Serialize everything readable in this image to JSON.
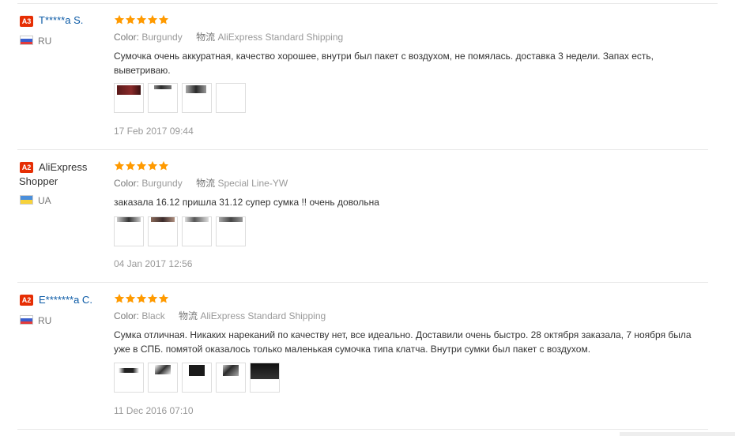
{
  "colors": {
    "badge": "#e62e04",
    "star": "#ff9a00",
    "link": "#0b5aa6"
  },
  "reviews": [
    {
      "badge": "A3",
      "name_line1": "T*****a S.",
      "name_line2": "",
      "country": "RU",
      "flag": "ru",
      "stars": 5,
      "color_label": "Color:",
      "color_value": "Burgundy",
      "shipping_label": "物流",
      "shipping_value": "AliExpress Standard Shipping",
      "text": "Сумочка очень аккуратная, качество хорошее, внутри был пакет с воздухом, не помялась. доставка 3 недели. Запах есть, выветриваю.",
      "thumbs": [
        "photo",
        "photo",
        "photo",
        "photo"
      ],
      "date": "17 Feb 2017 09:44"
    },
    {
      "badge": "A2",
      "name_line1": "AliExpress",
      "name_line2": "Shopper",
      "country": "UA",
      "flag": "ua",
      "stars": 5,
      "color_label": "Color:",
      "color_value": "Burgundy",
      "shipping_label": "物流",
      "shipping_value": "Special Line-YW",
      "text": "заказала 16.12 пришла 31.12 супер сумка !! очень довольна",
      "thumbs": [
        "photo",
        "photo",
        "photo",
        "photo"
      ],
      "date": "04 Jan 2017 12:56"
    },
    {
      "badge": "A2",
      "name_line1": "E*******a C.",
      "name_line2": "",
      "country": "RU",
      "flag": "ru",
      "stars": 5,
      "color_label": "Color:",
      "color_value": "Black",
      "shipping_label": "物流",
      "shipping_value": "AliExpress Standard Shipping",
      "text": "Сумка отличная. Никаких нареканий по качеству нет, все идеально. Доставили очень быстро. 28 октября заказала, 7 ноября была уже в СПБ. помятой оказалось только маленькая сумочка типа клатча. Внутри сумки был пакет с воздухом.",
      "thumbs": [
        "photo",
        "photo",
        "photo",
        "photo",
        "photo"
      ],
      "date": "11 Dec 2016 07:10"
    }
  ]
}
